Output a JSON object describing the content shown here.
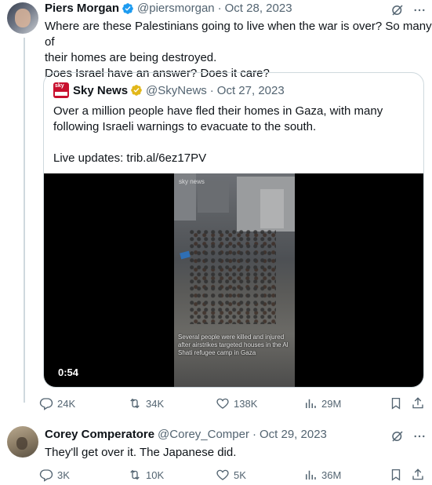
{
  "tweet1": {
    "name": "Piers Morgan",
    "handle": "@piersmorgan",
    "separator": "·",
    "date": "Oct 28, 2023",
    "text_line1": "Where are these Palestinians going to live when the war is over? So many of",
    "text_line2": "their homes are being destroyed.",
    "text_line3": "Does Israel have an answer? Does it care?",
    "quote": {
      "name": "Sky News",
      "handle": "@SkyNews",
      "separator": "·",
      "date": "Oct 27, 2023",
      "text_line1": "Over a million people have fled their homes in Gaza, with many",
      "text_line2": "following Israeli warnings to evacuate to the south.",
      "text_line3": "Live updates: trib.al/6ez17PV",
      "video_watermark": "sky news",
      "video_caption": "Several people were killed and injured after airstrikes targeted houses in the Al Shati refugee camp in Gaza",
      "duration": "0:54"
    },
    "actions": {
      "replies": "24K",
      "reposts": "34K",
      "likes": "138K",
      "views": "29M"
    }
  },
  "tweet2": {
    "name": "Corey Comperatore",
    "handle": "@Corey_Comper",
    "separator": "·",
    "date": "Oct 29, 2023",
    "text": "They'll get over it. The Japanese did.",
    "actions": {
      "replies": "3K",
      "reposts": "10K",
      "likes": "5K",
      "views": "36M"
    }
  },
  "icons": {
    "verified": "verified-badge-icon",
    "grok": "grok-icon",
    "reply": "reply-icon",
    "repost": "repost-icon",
    "like": "heart-icon",
    "views": "views-chart-icon",
    "bookmark": "bookmark-icon",
    "share": "share-icon"
  },
  "colors": {
    "text": "#0f1419",
    "secondary": "#536471",
    "border": "#cfd9de",
    "verified_gold": "#e2b719",
    "verified_blue": "#1d9bf0"
  }
}
